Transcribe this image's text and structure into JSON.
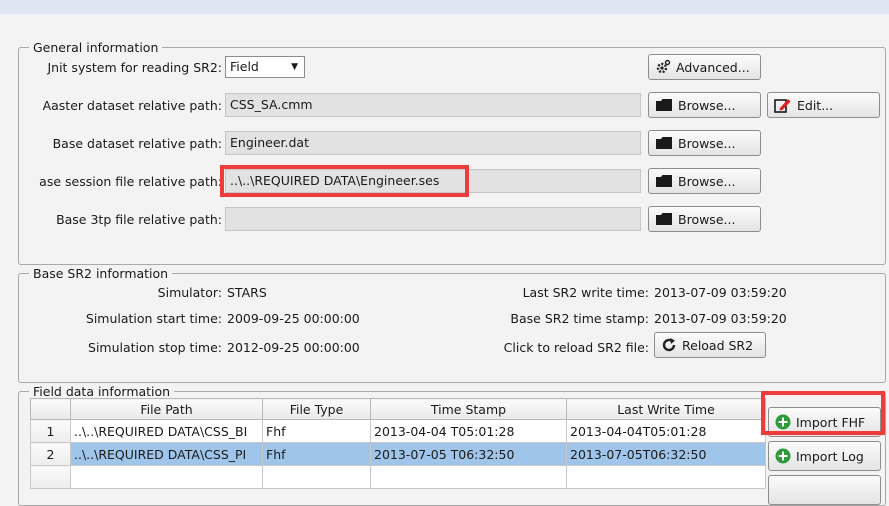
{
  "general": {
    "legend": "General information",
    "unit_label": "Jnit system for reading SR2:",
    "unit_value": "Field",
    "advanced_label": "Advanced...",
    "master_label": "Aaster dataset relative path:",
    "master_value": "CSS_SA.cmm",
    "browse_label": "Browse...",
    "edit_label": "Edit...",
    "base_dataset_label": "Base dataset relative path:",
    "base_dataset_value": "Engineer.dat",
    "session_label": "ase session file relative path:",
    "session_value": "..\\..\\REQUIRED DATA\\Engineer.ses",
    "base3tp_label": "Base 3tp file relative path:",
    "base3tp_value": ""
  },
  "sr2": {
    "legend": "Base SR2 information",
    "simulator_label": "Simulator:",
    "simulator_value": "STARS",
    "start_label": "Simulation start time:",
    "start_value": "2009-09-25 00:00:00",
    "stop_label": "Simulation stop time:",
    "stop_value": "2012-09-25 00:00:00",
    "last_write_label": "Last SR2 write time:",
    "last_write_value": "2013-07-09 03:59:20",
    "stamp_label": "Base SR2 time stamp:",
    "stamp_value": "2013-07-09 03:59:20",
    "reload_prompt": "Click to reload SR2 file:",
    "reload_label": "Reload SR2"
  },
  "field": {
    "legend": "Field data information",
    "columns": [
      "File Path",
      "File Type",
      "Time Stamp",
      "Last Write Time"
    ],
    "rows": [
      {
        "num": "1",
        "path": "..\\..\\REQUIRED DATA\\CSS_BI",
        "type": "Fhf",
        "stamp": "2013-04-04 T05:01:28",
        "write": "2013-04-04T05:01:28"
      },
      {
        "num": "2",
        "path": "..\\..\\REQUIRED DATA\\CSS_PI",
        "type": "Fhf",
        "stamp": "2013-07-05 T06:32:50",
        "write": "2013-07-05T06:32:50"
      }
    ],
    "import_fhf_label": "Import FHF",
    "import_log_label": "Import Log"
  },
  "colors": {
    "highlight_red": "#ee3b3b",
    "selected_row": "#9fc6ea",
    "import_icon_green": "#2e9a3a"
  },
  "icons": [
    "gear-icon",
    "folder-icon",
    "edit-icon",
    "reload-icon",
    "plus-circle-icon"
  ]
}
